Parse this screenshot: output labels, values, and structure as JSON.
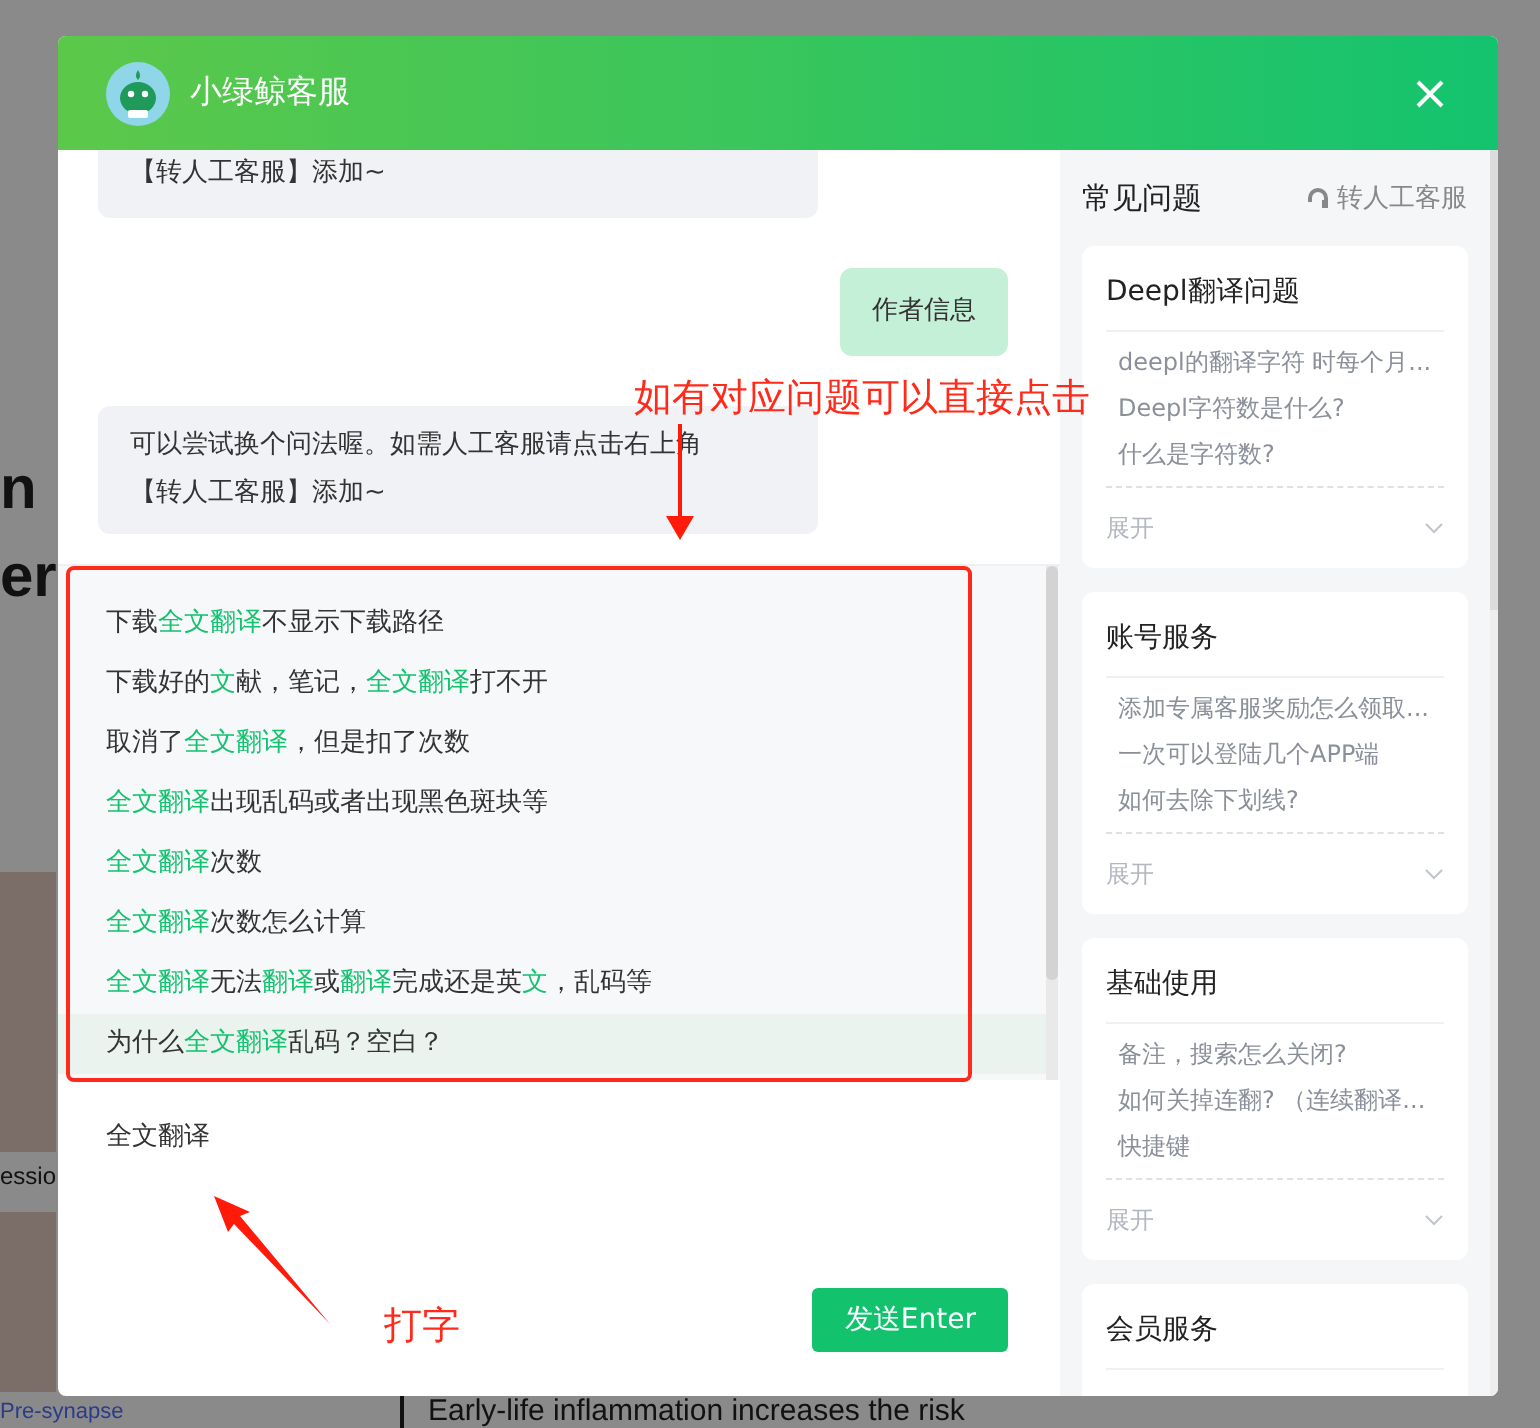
{
  "window": {
    "title": "小绿鲸客服"
  },
  "background_page": {
    "fragments": [
      {
        "kind": "heading",
        "text": "n"
      },
      {
        "kind": "heading",
        "text": "er"
      },
      {
        "kind": "caption",
        "text": "essio"
      },
      {
        "kind": "label",
        "text": "Pre-synapse"
      }
    ],
    "headline": "Early-life inflammation increases the risk"
  },
  "chat": {
    "messages": [
      {
        "kind": "bot",
        "lines": [
          "【转人工客服】添加~"
        ]
      },
      {
        "kind": "user",
        "lines": [
          "作者信息"
        ]
      },
      {
        "kind": "bot",
        "lines": [
          "可以尝试换个问法喔。如需人工客服请点击右上角",
          "【转人工客服】添加~"
        ]
      }
    ],
    "suggestions": [
      {
        "selected": false,
        "segments": [
          {
            "text": "下载",
            "hit": false
          },
          {
            "text": "全文翻译",
            "hit": true
          },
          {
            "text": "不显示下载路径",
            "hit": false
          }
        ]
      },
      {
        "selected": false,
        "segments": [
          {
            "text": "下载好的",
            "hit": false
          },
          {
            "text": "文",
            "hit": true
          },
          {
            "text": "献，笔记，",
            "hit": false
          },
          {
            "text": "全文翻译",
            "hit": true
          },
          {
            "text": "打不开",
            "hit": false
          }
        ]
      },
      {
        "selected": false,
        "segments": [
          {
            "text": "取消了",
            "hit": false
          },
          {
            "text": "全文翻译",
            "hit": true
          },
          {
            "text": "，但是扣了次数",
            "hit": false
          }
        ]
      },
      {
        "selected": false,
        "segments": [
          {
            "text": "全文翻译",
            "hit": true
          },
          {
            "text": "出现乱码或者出现黑色斑块等",
            "hit": false
          }
        ]
      },
      {
        "selected": false,
        "segments": [
          {
            "text": "全文翻译",
            "hit": true
          },
          {
            "text": "次数",
            "hit": false
          }
        ]
      },
      {
        "selected": false,
        "segments": [
          {
            "text": "全文翻译",
            "hit": true
          },
          {
            "text": "次数怎么计算",
            "hit": false
          }
        ]
      },
      {
        "selected": false,
        "segments": [
          {
            "text": "全文翻译",
            "hit": true
          },
          {
            "text": "无法",
            "hit": false
          },
          {
            "text": "翻译",
            "hit": true
          },
          {
            "text": "或",
            "hit": false
          },
          {
            "text": "翻译",
            "hit": true
          },
          {
            "text": "完成还是英",
            "hit": false
          },
          {
            "text": "文",
            "hit": true
          },
          {
            "text": "，乱码等",
            "hit": false
          }
        ]
      },
      {
        "selected": true,
        "segments": [
          {
            "text": "为什么",
            "hit": false
          },
          {
            "text": "全文翻译",
            "hit": true
          },
          {
            "text": "乱码？空白？",
            "hit": false
          }
        ]
      }
    ],
    "input": {
      "value": "全文翻译"
    },
    "send_button": "发送Enter"
  },
  "annotations": [
    {
      "kind": "callout",
      "text": "如有对应问题可以直接点击"
    },
    {
      "kind": "pointer",
      "text": "打字"
    }
  ],
  "sidebar": {
    "title": "常见问题",
    "human_service": "转人工客服",
    "cards": [
      {
        "title": "Deepl翻译问题",
        "items": [
          "deepl的翻译字符 时每个月...",
          "Deepl字符数是什么?",
          "什么是字符数?"
        ],
        "expand": "展开"
      },
      {
        "title": "账号服务",
        "items": [
          "添加专属客服奖励怎么领取...",
          "一次可以登陆几个APP端",
          "如何去除下划线?"
        ],
        "expand": "展开"
      },
      {
        "title": "基础使用",
        "items": [
          "备注，搜索怎么关闭?",
          "如何关掉连翻? （连续翻译...",
          "快捷键"
        ],
        "expand": "展开"
      },
      {
        "title": "会员服务"
      }
    ]
  }
}
